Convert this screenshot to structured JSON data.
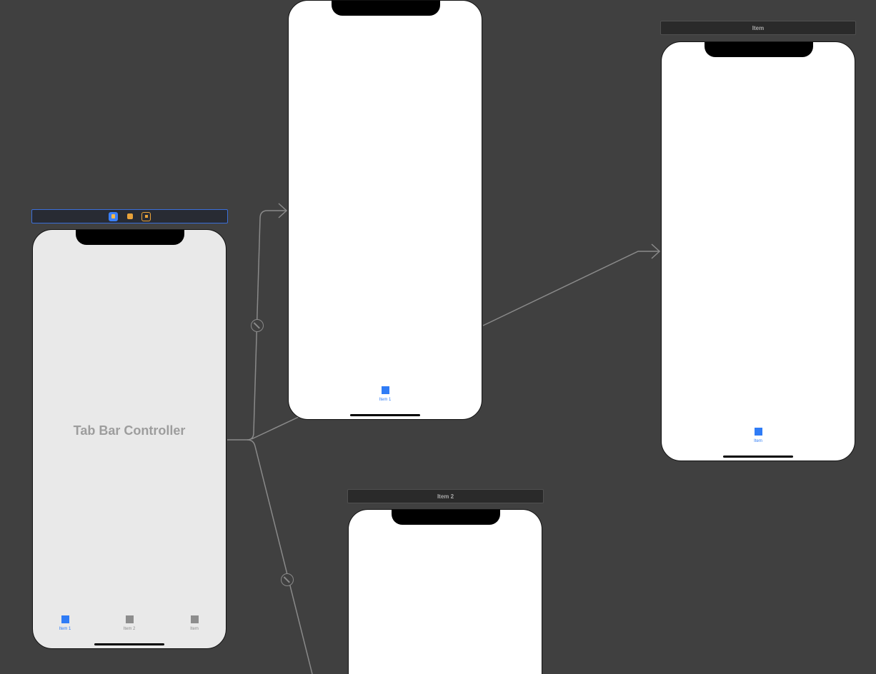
{
  "tab_bar_controller": {
    "title": "Tab Bar Controller",
    "dock_icons": [
      "view-controller-icon",
      "first-responder-icon",
      "exit-icon"
    ],
    "tabs": [
      {
        "label": "Item 1",
        "active": true
      },
      {
        "label": "Item 2",
        "active": false
      },
      {
        "label": "Item",
        "active": false
      }
    ]
  },
  "scene_item1": {
    "tab_label": "Item 1"
  },
  "scene_item": {
    "bar_title": "Item",
    "tab_label": "Item"
  },
  "scene_item2": {
    "bar_title": "Item 2"
  },
  "colors": {
    "canvas": "#404040",
    "accent": "#2f7cf6",
    "connection": "#8a8a8a",
    "phone_bg": "#ffffff",
    "tbc_bg": "#e9e9e9"
  }
}
